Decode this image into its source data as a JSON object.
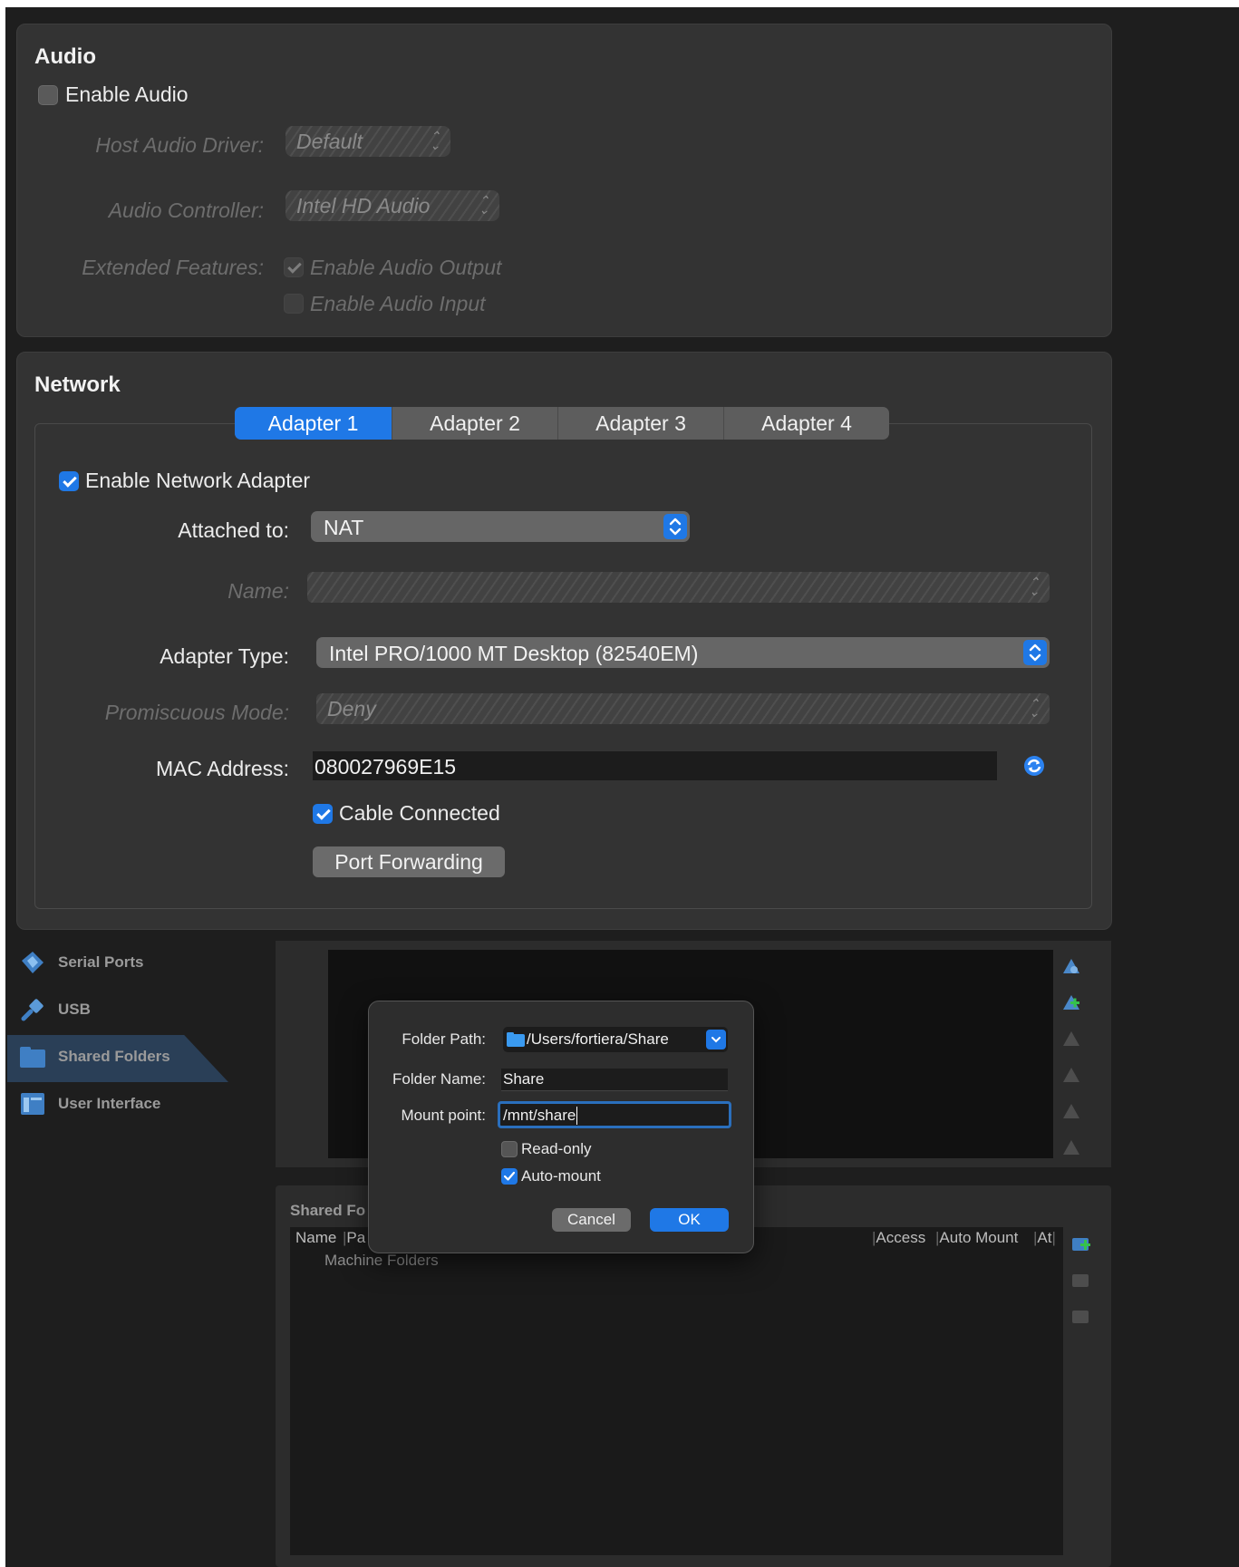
{
  "audio": {
    "title": "Audio",
    "enable_audio_label": "Enable Audio",
    "enable_audio_checked": false,
    "host_driver_label": "Host Audio Driver:",
    "host_driver_value": "Default",
    "controller_label": "Audio Controller:",
    "controller_value": "Intel HD Audio",
    "extended_label": "Extended Features:",
    "output_label": "Enable Audio Output",
    "input_label": "Enable Audio Input"
  },
  "network": {
    "title": "Network",
    "tabs": [
      {
        "label": "Adapter 1"
      },
      {
        "label": "Adapter 2"
      },
      {
        "label": "Adapter 3"
      },
      {
        "label": "Adapter 4"
      }
    ],
    "active_tab": "Adapter 1",
    "enable_adapter_label": "Enable Network Adapter",
    "attached_label": "Attached to:",
    "attached_value": "NAT",
    "name_label": "Name:",
    "name_value": "",
    "adapter_type_label": "Adapter Type:",
    "adapter_type_value": "Intel PRO/1000 MT Desktop (82540EM)",
    "promiscuous_label": "Promiscuous Mode:",
    "promiscuous_value": "Deny",
    "mac_label": "MAC Address:",
    "mac_value": "080027969E15",
    "cable_label": "Cable Connected",
    "cable_checked": true,
    "port_forwarding_label": "Port Forwarding"
  },
  "sidebar": {
    "items": [
      {
        "label": "Serial Ports",
        "icon": "serial-port-icon"
      },
      {
        "label": "USB",
        "icon": "usb-icon"
      },
      {
        "label": "Shared Folders",
        "icon": "folder-icon"
      },
      {
        "label": "User Interface",
        "icon": "user-interface-icon"
      }
    ],
    "selected": "Shared Folders"
  },
  "shared_folders": {
    "section_title": "Shared Fo",
    "columns": [
      "Name",
      "Pa",
      "Access",
      "Auto Mount",
      "At"
    ],
    "rows": [
      "Machine Folders"
    ]
  },
  "dialog": {
    "folder_path_label": "Folder Path:",
    "folder_path_value": "/Users/fortiera/Share",
    "folder_name_label": "Folder Name:",
    "folder_name_value": "Share",
    "mount_point_label": "Mount point:",
    "mount_point_value": "/mnt/share",
    "read_only_label": "Read-only",
    "read_only_checked": false,
    "auto_mount_label": "Auto-mount",
    "auto_mount_checked": true,
    "cancel_label": "Cancel",
    "ok_label": "OK"
  },
  "colors": {
    "accent": "#1f78e6",
    "panel": "#333333",
    "window": "#1e1e1e"
  }
}
